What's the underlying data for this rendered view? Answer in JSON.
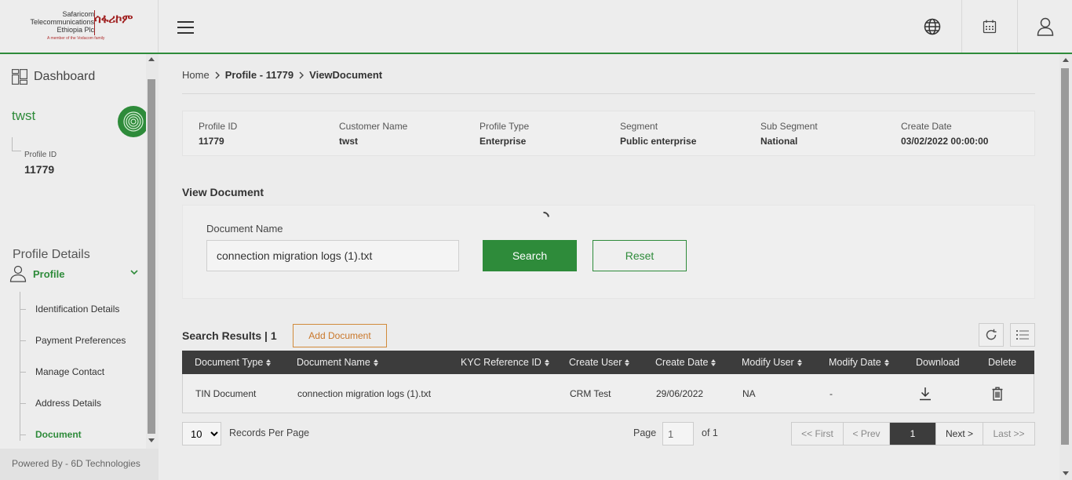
{
  "header": {
    "logo_text_en_1": "Safaricom",
    "logo_text_en_2": "Telecommunications",
    "logo_text_en_3": "Ethiopia Plc",
    "logo_text_am": "ሳፋሪኮም",
    "logo_tagline": "A member of the Vodacom family",
    "icons": [
      "menu-icon",
      "globe-icon",
      "calendar-icon",
      "user-icon"
    ],
    "accent_color": "#2e8b3a"
  },
  "sidebar": {
    "dashboard_label": "Dashboard",
    "customer_name": "twst",
    "profile_id_label": "Profile ID",
    "profile_id_value": "11779",
    "section_title": "Profile Details",
    "profile_label": "Profile",
    "items": [
      {
        "label": "Identification Details"
      },
      {
        "label": "Payment Preferences"
      },
      {
        "label": "Manage Contact"
      },
      {
        "label": "Address Details"
      },
      {
        "label": "Document"
      }
    ],
    "active_item": "Document",
    "footer": "Powered By - 6D Technologies"
  },
  "breadcrumb": {
    "home": "Home",
    "profile": "Profile - 11779",
    "current": "ViewDocument"
  },
  "profile_info": [
    {
      "label": "Profile ID",
      "value": "11779"
    },
    {
      "label": "Customer Name",
      "value": "twst"
    },
    {
      "label": "Profile Type",
      "value": "Enterprise"
    },
    {
      "label": "Segment",
      "value": "Public enterprise"
    },
    {
      "label": "Sub Segment",
      "value": "National"
    },
    {
      "label": "Create Date",
      "value": "03/02/2022 00:00:00"
    }
  ],
  "view_document": {
    "title": "View Document",
    "field_label": "Document Name",
    "field_value": "connection migration logs (1).txt",
    "search_label": "Search",
    "reset_label": "Reset"
  },
  "results": {
    "title": "Search Results | 1",
    "add_label": "Add Document",
    "columns": [
      "Document Type",
      "Document Name",
      "KYC Reference ID",
      "Create User",
      "Create Date",
      "Modify User",
      "Modify Date",
      "Download",
      "Delete"
    ],
    "rows": [
      {
        "document_type": "TIN Document",
        "document_name": "connection migration logs (1).txt",
        "kyc_reference_id": "",
        "create_user": "CRM Test",
        "create_date": "29/06/2022",
        "modify_user": "NA",
        "modify_date": "-"
      }
    ]
  },
  "pagination": {
    "per_page": "10",
    "per_page_label": "Records Per Page",
    "page_label": "Page",
    "page_value": "1",
    "of_label": "of 1",
    "first": "<< First",
    "prev": "< Prev",
    "current": "1",
    "next": "Next >",
    "last": "Last >>"
  }
}
